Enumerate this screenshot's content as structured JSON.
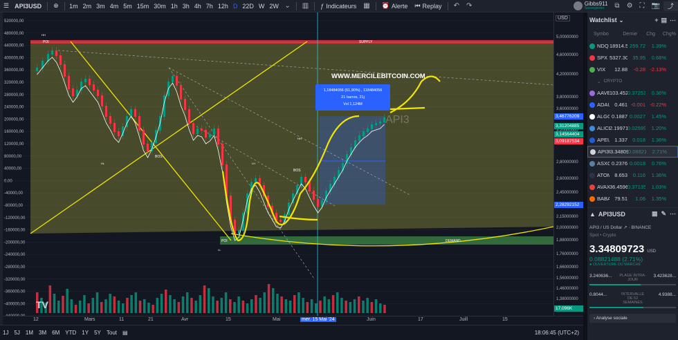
{
  "toolbar": {
    "symbol": "API3USD",
    "intervals": [
      "1m",
      "2m",
      "3m",
      "4m",
      "5m",
      "15m",
      "30m",
      "1h",
      "3h",
      "4h",
      "7h",
      "12h",
      "D",
      "22D",
      "W",
      "2W"
    ],
    "active_interval": "D",
    "indicators": "Indicateurs",
    "alert": "Alerte",
    "replay": "Replay",
    "user": "Gibbs911",
    "user_sub": "Sauvegarder"
  },
  "chart": {
    "watermark": "WWW.MERCILEBITCOIN.COM",
    "symbol_watermark": "API3",
    "measure_line1": "1,18484056 (51,90%) , 118484056",
    "measure_line2": "21 barres, 21j",
    "measure_line3": "Vol 1,124M",
    "labels": {
      "poi_top": "POI",
      "supply": "SUPPLY",
      "poi_bottom": "POI",
      "demand": "DEMAND",
      "bos1": "BOS",
      "bos2": "BOS",
      "hh": "HH",
      "hl": "HL",
      "ll": "LL",
      "lh": "LH",
      "hh2": "HH"
    },
    "left_axis": [
      "520000,00",
      "480000,00",
      "440000,00",
      "400000,00",
      "360000,00",
      "320000,00",
      "280000,00",
      "240000,00",
      "200000,00",
      "160000,00",
      "120000,00",
      "80000,00",
      "40000,00",
      "0,00",
      "-40000,00",
      "-80000,00",
      "-120000,00",
      "-160000,00",
      "-200000,00",
      "-240000,00",
      "-280000,00",
      "-320000,00",
      "-360000,00",
      "-400000,00",
      "-440000,00"
    ],
    "volume_badge": "17,096K",
    "colors": {
      "up": "#089981",
      "down": "#f23645",
      "supply": "#f23645",
      "demand": "#4caf50",
      "zone": "#8a8a3a",
      "marker": "#f2e500"
    }
  },
  "price_scale": {
    "currency": "USD",
    "ticks": [
      "5,00000000",
      "4,60000000",
      "4,20000000",
      "3,80000000",
      "3,60000000",
      "3,20000000",
      "2,80000000",
      "2,60000000",
      "2,45000000",
      "2,30000000",
      "2,15000000",
      "2,00000000",
      "1,88000000",
      "1,76000000",
      "1,66000000",
      "1,56000000",
      "1,46000000",
      "1,38000000"
    ],
    "badges": [
      {
        "value": "3,46776209",
        "color": "#2962ff"
      },
      {
        "value": "3,31204885",
        "color": "#089981"
      },
      {
        "value": "3,14564404",
        "color": "#089981"
      },
      {
        "value": "3,09187534",
        "color": "#f23645"
      },
      {
        "value": "2,28292152",
        "color": "#2962ff"
      }
    ]
  },
  "timebar": {
    "ticks": [
      "12",
      "Mars",
      "11",
      "21",
      "Avr",
      "15",
      "Mai",
      "Juin",
      "17",
      "Juill",
      "15"
    ],
    "selected": "mer. 15 Mai '24"
  },
  "rangebar": {
    "ranges": [
      "1J",
      "5J",
      "1M",
      "3M",
      "6M",
      "YTD",
      "1Y",
      "5Y",
      "Tout"
    ],
    "time": "18:06:45 (UTC+2)"
  },
  "watchlist": {
    "title": "Watchlist",
    "columns": [
      "Symbo",
      "Dernie",
      "Chg",
      "Chg%"
    ],
    "section": "CRYPTO",
    "rows_top": [
      {
        "sym": "NDQ",
        "last": "18914.5",
        "chg": "259.72",
        "chgp": "1.39%",
        "dir": "pos",
        "dot": "#089981"
      },
      {
        "sym": "SPX",
        "last": "5327.30",
        "chg": "35.95",
        "chgp": "0.68%",
        "dir": "pos",
        "dot": "#f23645"
      },
      {
        "sym": "VIX",
        "last": "12.88",
        "chg": "-0.28",
        "chgp": "-2.13%",
        "dir": "neg",
        "dot": "#4caf50"
      }
    ],
    "rows_crypto": [
      {
        "sym": "AAVE",
        "last": "103.452",
        "chg": "0.37253",
        "chgp": "0.36%",
        "dir": "pos",
        "dot": "#9c6ade"
      },
      {
        "sym": "ADAU",
        "last": "0.461",
        "chg": "-0.001",
        "chgp": "-0.22%",
        "dir": "neg",
        "dot": "#2962ff"
      },
      {
        "sym": "ALGO",
        "last": "0.1887",
        "chg": "0.0027",
        "chgp": "1.45%",
        "dir": "pos",
        "dot": "#ffffff"
      },
      {
        "sym": "ALICE",
        "last": "2.19971",
        "chg": "0.02599",
        "chgp": "1.20%",
        "dir": "pos",
        "dot": "#3f8cd8"
      },
      {
        "sym": "APEU",
        "last": "1.337",
        "chg": "0.018",
        "chgp": "1.36%",
        "dir": "pos",
        "dot": "#1e5ed8"
      },
      {
        "sym": "API3U",
        "last": "3.34809",
        "chg": "0.08821",
        "chgp": "2.71%",
        "dir": "pos",
        "dot": "#d1d4dc",
        "selected": true
      },
      {
        "sym": "ASXC",
        "last": "0.2376",
        "chg": "0.0018",
        "chgp": "0.76%",
        "dir": "pos",
        "dot": "#5b7fa6"
      },
      {
        "sym": "ATOM",
        "last": "8.653",
        "chg": "0.116",
        "chgp": "1.36%",
        "dir": "pos",
        "dot": "#2e3148"
      },
      {
        "sym": "AVAX",
        "last": "36.4596",
        "chg": "0.37135",
        "chgp": "1.03%",
        "dir": "pos",
        "dot": "#e84142"
      },
      {
        "sym": "BABA",
        "last": "79.51",
        "chg": "1.06",
        "chgp": "1.35%",
        "dir": "pos",
        "dot": "#ff6a00"
      }
    ]
  },
  "detail": {
    "symbol": "API3USD",
    "name": "API3 / US Dollar",
    "exchange": "BINANCE",
    "type": "Spot • Crypto",
    "price": "3.34809723",
    "currency": "USD",
    "change": "0.08821488 (2.71%)",
    "open_status": "OUVERTURE DU MARCHÉ",
    "day_low": "3.240636...",
    "day_label": "PLAGE INTRA-JOUR",
    "day_high": "3.423628...",
    "year_low": "0.8044...",
    "year_label": "INTERVALLE DE 52 SEMAINES",
    "year_high": "4.9388...",
    "day_range_fraction": 0.59,
    "year_range_fraction": 0.62,
    "social": "Analyse sociale"
  }
}
